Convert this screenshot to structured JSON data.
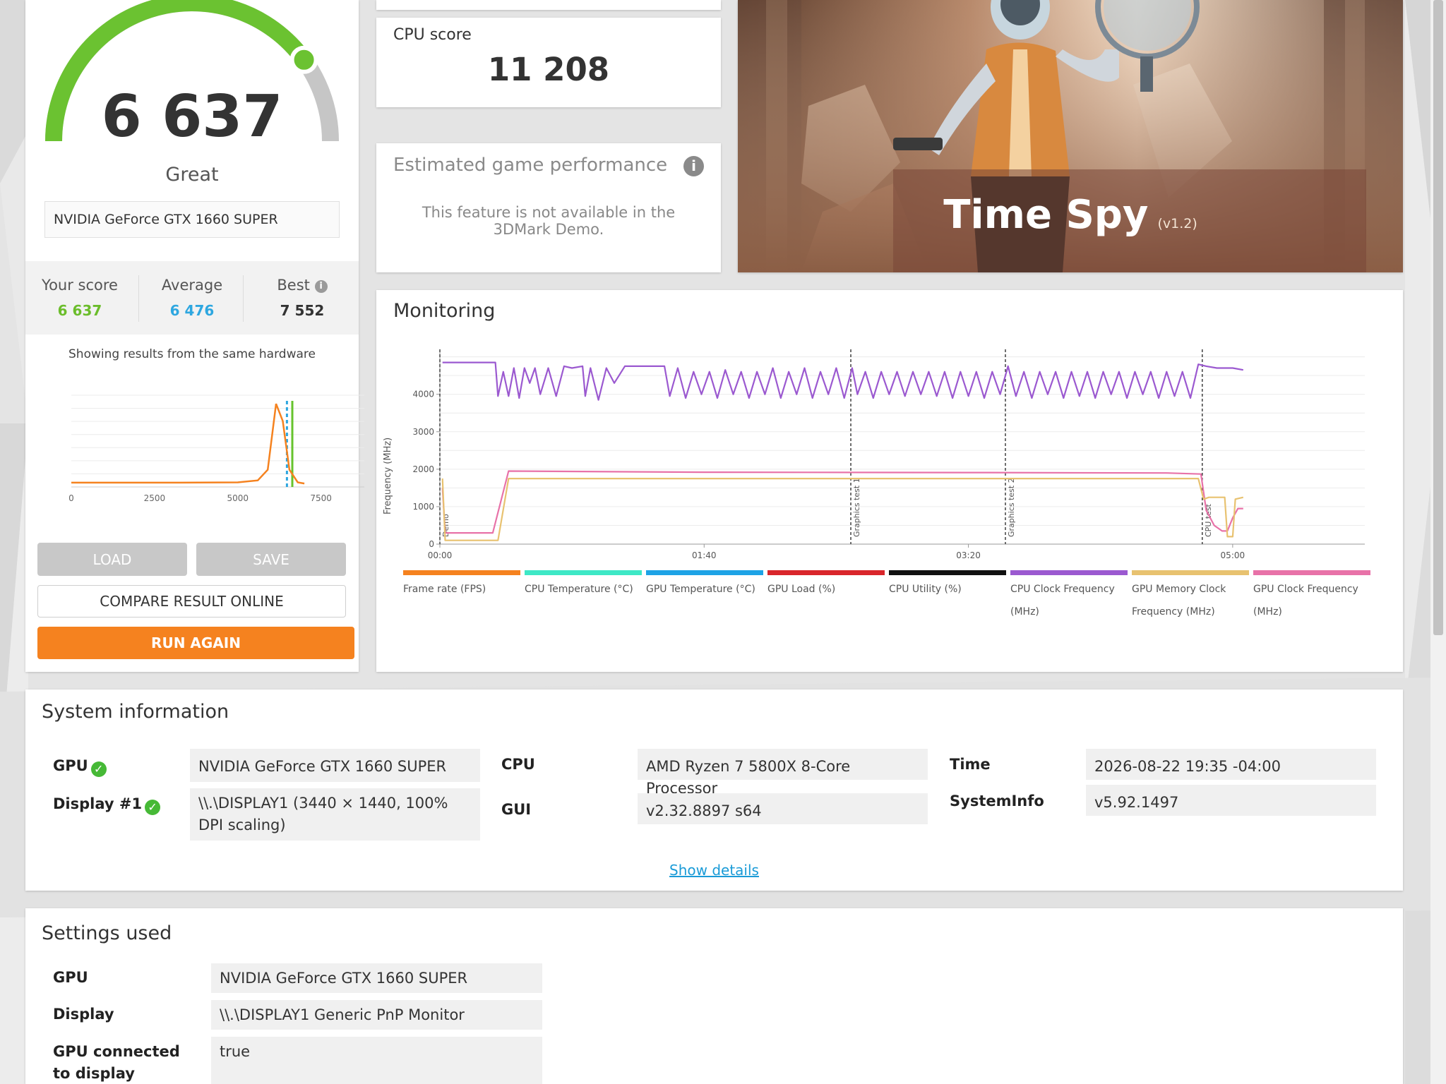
{
  "score_panel": {
    "score": "6 637",
    "rating": "Great",
    "gpu_name": "NVIDIA GeForce GTX 1660 SUPER",
    "gauge_fraction": 0.8,
    "your_score_label": "Your score",
    "your_score": "6 637",
    "average_label": "Average",
    "average": "6 476",
    "best_label": "Best",
    "best": "7 552",
    "hardware_note": "Showing results from the same hardware",
    "load_label": "LOAD",
    "save_label": "SAVE",
    "compare_label": "COMPARE RESULT ONLINE",
    "run_again_label": "RUN AGAIN"
  },
  "cpu_score": {
    "label": "CPU score",
    "value": "11 208"
  },
  "estimated": {
    "title": "Estimated game performance",
    "message": "This feature is not available in the 3DMark Demo."
  },
  "hero": {
    "title": "Time Spy",
    "version": "(v1.2)"
  },
  "monitoring": {
    "title": "Monitoring",
    "ylabel": "Frequency (MHz)",
    "legend": [
      {
        "label": "Frame rate (FPS)",
        "color": "#f5821f"
      },
      {
        "label": "CPU Temperature (°C)",
        "color": "#3ee8c6"
      },
      {
        "label": "GPU Temperature (°C)",
        "color": "#1ea3e6"
      },
      {
        "label": "GPU Load (%)",
        "color": "#d9262b"
      },
      {
        "label": "CPU Utility (%)",
        "color": "#111111"
      },
      {
        "label": "CPU Clock Frequency (MHz)",
        "color": "#9b59d0"
      },
      {
        "label": "GPU Memory Clock Frequency (MHz)",
        "color": "#e8c270"
      },
      {
        "label": "GPU Clock Frequency (MHz)",
        "color": "#e872a8"
      }
    ]
  },
  "chart_data": [
    {
      "type": "line",
      "title": "",
      "xlabel": "",
      "ylabel": "",
      "x_ticks": [
        "0",
        "2500",
        "5000",
        "7500"
      ],
      "xlim": [
        0,
        8800
      ],
      "series": [
        {
          "points": [
            [
              0,
              150
            ],
            [
              3000,
              150
            ],
            [
              5000,
              160
            ],
            [
              5600,
              230
            ],
            [
              5900,
              600
            ],
            [
              6150,
              2900
            ],
            [
              6350,
              2300
            ],
            [
              6550,
              600
            ],
            [
              6800,
              160
            ],
            [
              7000,
              120
            ]
          ]
        }
      ],
      "markers": [
        {
          "value": 6476,
          "color": "#2ea7e0"
        },
        {
          "value": 6637,
          "color": "#66c32d"
        }
      ]
    },
    {
      "type": "line",
      "title": "",
      "xlabel": "",
      "ylabel": "Frequency (MHz)",
      "ylim": [
        0,
        5200
      ],
      "y_ticks": [
        0,
        1000,
        2000,
        3000,
        4000
      ],
      "x_ticks": [
        "00:00",
        "01:40",
        "03:20",
        "05:00"
      ],
      "xlim_seconds": [
        0,
        350
      ],
      "section_markers": [
        {
          "label": "Demo",
          "t": 0
        },
        {
          "label": "Graphics test 1",
          "t": 155.5
        },
        {
          "label": "Graphics test 2",
          "t": 214
        },
        {
          "label": "CPU test",
          "t": 288.5
        }
      ],
      "series": [
        {
          "name": "CPU Clock Frequency (MHz)",
          "color": "#9b59d0",
          "points": [
            [
              1,
              4850
            ],
            [
              21,
              4850
            ],
            [
              22,
              3950
            ],
            [
              24,
              4600
            ],
            [
              26,
              3950
            ],
            [
              28,
              4700
            ],
            [
              30,
              3900
            ],
            [
              32,
              4700
            ],
            [
              34,
              4300
            ],
            [
              36,
              4700
            ],
            [
              38,
              4000
            ],
            [
              41,
              4700
            ],
            [
              44,
              3950
            ],
            [
              47,
              4750
            ],
            [
              50,
              4700
            ],
            [
              54,
              4750
            ],
            [
              55,
              3950
            ],
            [
              57,
              4700
            ],
            [
              60,
              3850
            ],
            [
              63,
              4700
            ],
            [
              66,
              4300
            ],
            [
              70,
              4750
            ],
            [
              85,
              4750
            ],
            [
              87,
              3950
            ],
            [
              90,
              4700
            ],
            [
              93,
              3900
            ],
            [
              96,
              4600
            ],
            [
              99,
              4000
            ],
            [
              102,
              4600
            ],
            [
              105,
              3900
            ],
            [
              108,
              4650
            ],
            [
              111,
              4000
            ],
            [
              114,
              4600
            ],
            [
              117,
              3900
            ],
            [
              120,
              4600
            ],
            [
              123,
              4000
            ],
            [
              126,
              4700
            ],
            [
              129,
              3900
            ],
            [
              132,
              4600
            ],
            [
              135,
              4000
            ],
            [
              138,
              4700
            ],
            [
              141,
              3900
            ],
            [
              144,
              4600
            ],
            [
              147,
              4000
            ],
            [
              150,
              4700
            ],
            [
              153,
              3900
            ],
            [
              156,
              4700
            ],
            [
              158,
              4000
            ],
            [
              161,
              4600
            ],
            [
              164,
              3900
            ],
            [
              167,
              4600
            ],
            [
              170,
              4000
            ],
            [
              173,
              4600
            ],
            [
              176,
              3950
            ],
            [
              179,
              4600
            ],
            [
              182,
              4000
            ],
            [
              185,
              4600
            ],
            [
              188,
              3950
            ],
            [
              191,
              4600
            ],
            [
              194,
              3900
            ],
            [
              197,
              4600
            ],
            [
              200,
              3950
            ],
            [
              203,
              4600
            ],
            [
              206,
              3900
            ],
            [
              209,
              4600
            ],
            [
              212,
              4000
            ],
            [
              215,
              4750
            ],
            [
              218,
              3950
            ],
            [
              221,
              4600
            ],
            [
              224,
              3900
            ],
            [
              227,
              4600
            ],
            [
              230,
              4000
            ],
            [
              233,
              4600
            ],
            [
              236,
              3900
            ],
            [
              239,
              4600
            ],
            [
              242,
              3950
            ],
            [
              245,
              4600
            ],
            [
              248,
              3900
            ],
            [
              251,
              4600
            ],
            [
              254,
              4000
            ],
            [
              257,
              4600
            ],
            [
              260,
              3900
            ],
            [
              263,
              4600
            ],
            [
              266,
              4000
            ],
            [
              269,
              4600
            ],
            [
              272,
              3900
            ],
            [
              275,
              4600
            ],
            [
              278,
              3950
            ],
            [
              281,
              4600
            ],
            [
              284,
              3900
            ],
            [
              287,
              4800
            ],
            [
              290,
              4750
            ],
            [
              294,
              4700
            ],
            [
              300,
              4700
            ],
            [
              304,
              4650
            ]
          ]
        },
        {
          "name": "GPU Clock Frequency (MHz)",
          "color": "#e872a8",
          "points": [
            [
              1,
              1500
            ],
            [
              2,
              300
            ],
            [
              20,
              300
            ],
            [
              26,
              1950
            ],
            [
              100,
              1920
            ],
            [
              200,
              1910
            ],
            [
              275,
              1900
            ],
            [
              288,
              1870
            ],
            [
              290,
              900
            ],
            [
              293,
              500
            ],
            [
              296,
              350
            ],
            [
              298,
              350
            ],
            [
              300,
              700
            ],
            [
              302,
              950
            ],
            [
              304,
              950
            ]
          ]
        },
        {
          "name": "GPU Memory Clock Frequency (MHz)",
          "color": "#e8c270",
          "points": [
            [
              1,
              1750
            ],
            [
              2,
              100
            ],
            [
              22,
              100
            ],
            [
              26,
              1750
            ],
            [
              100,
              1750
            ],
            [
              200,
              1750
            ],
            [
              287,
              1750
            ],
            [
              289,
              1200
            ],
            [
              291,
              1250
            ],
            [
              297,
              1250
            ],
            [
              298,
              200
            ],
            [
              300,
              200
            ],
            [
              301,
              1200
            ],
            [
              304,
              1250
            ]
          ]
        }
      ]
    }
  ],
  "system_info": {
    "title": "System information",
    "gpu_label": "GPU",
    "gpu_value": "NVIDIA GeForce GTX 1660 SUPER",
    "display_label": "Display #1",
    "display_value": "\\\\.\\DISPLAY1 (3440 × 1440, 100% DPI scaling)",
    "cpu_label": "CPU",
    "cpu_value": "AMD Ryzen 7 5800X 8-Core Processor",
    "gui_label": "GUI",
    "gui_value": "v2.32.8897 s64",
    "time_label": "Time",
    "time_value": "2026-08-22 19:35 -04:00",
    "sysinfo_label": "SystemInfo",
    "sysinfo_value": "v5.92.1497",
    "show_details": "Show details"
  },
  "settings": {
    "title": "Settings used",
    "gpu_label": "GPU",
    "gpu_value": "NVIDIA GeForce GTX 1660 SUPER",
    "display_label": "Display",
    "display_value": "\\\\.\\DISPLAY1 Generic PnP Monitor",
    "connected_label": "GPU connected to display",
    "connected_value": "true"
  }
}
